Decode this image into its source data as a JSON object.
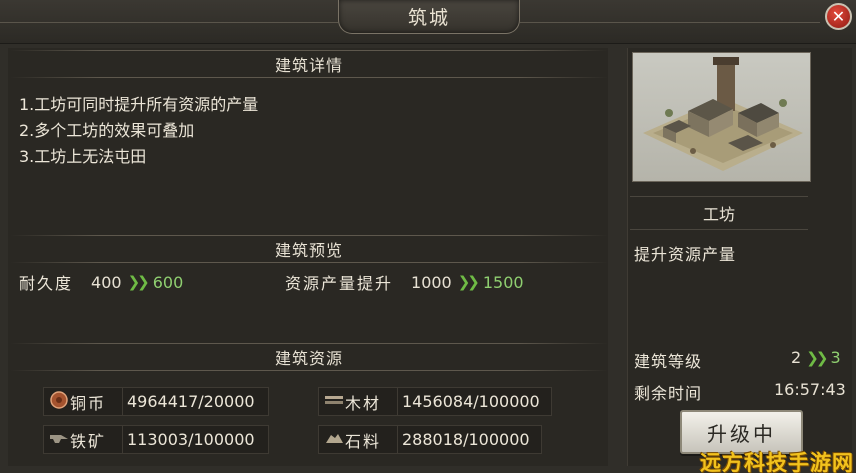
{
  "window": {
    "title": "筑城",
    "close_icon": "✕"
  },
  "details": {
    "header": "建筑详情",
    "lines": [
      "1.工坊可同时提升所有资源的产量",
      "2.多个工坊的效果可叠加",
      "3.工坊上无法屯田"
    ]
  },
  "preview": {
    "header": "建筑预览",
    "stats": [
      {
        "label": "耐久度",
        "old": "400",
        "new": "600"
      },
      {
        "label": "资源产量提升",
        "old": "1000",
        "new": "1500"
      }
    ]
  },
  "resources": {
    "header": "建筑资源",
    "items": [
      {
        "icon": "coin-icon",
        "name": "铜币",
        "value": "4964417/20000"
      },
      {
        "icon": "wood-icon",
        "name": "木材",
        "value": "1456084/100000"
      },
      {
        "icon": "iron-ore-icon",
        "name": "铁矿",
        "value": "113003/100000"
      },
      {
        "icon": "stone-icon",
        "name": "石料",
        "value": "288018/100000"
      }
    ]
  },
  "building": {
    "name": "工坊",
    "description": "提升资源产量",
    "level_label": "建筑等级",
    "level_from": "2",
    "level_to": "3",
    "time_label": "剩余时间",
    "time_value": "16:57:43"
  },
  "upgrade_button": "升级中",
  "watermark": "远方科技手游网",
  "colors": {
    "increase": "#8fcf70",
    "close": "#c8281d",
    "watermark": "#f2c21d"
  }
}
